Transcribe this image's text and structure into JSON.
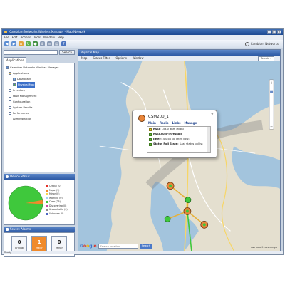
{
  "app": {
    "title": "Cambium Networks Wireless Manager - Map Network",
    "menu": [
      "File",
      "Edit",
      "Actions",
      "Tools",
      "Window",
      "Help"
    ],
    "brand": "Cambium Networks",
    "status_text": "Ready"
  },
  "left": {
    "search_button": "Search",
    "tab": "Applications",
    "tree": [
      {
        "label": "Cambium Networks Wireless Manager",
        "level": 0
      },
      {
        "label": "Applications",
        "level": 1
      },
      {
        "label": "Dashboard",
        "level": 2
      },
      {
        "label": "Physical Map",
        "level": 2,
        "selected": true
      },
      {
        "label": "Inventory",
        "level": 2
      },
      {
        "label": "Fault Management",
        "level": 2
      },
      {
        "label": "Configuration",
        "level": 2
      },
      {
        "label": "System Results",
        "level": 2
      },
      {
        "label": "Performance",
        "level": 2
      },
      {
        "label": "Administration",
        "level": 2
      }
    ]
  },
  "device_status": {
    "title": "Device Status",
    "legend": [
      {
        "label": "Critical (0)",
        "color": "#e53027"
      },
      {
        "label": "Major (1)",
        "color": "#f08a2b"
      },
      {
        "label": "Minor (0)",
        "color": "#f6d54b"
      },
      {
        "label": "Warning (0)",
        "color": "#9fd3f3"
      },
      {
        "label": "Clear (25)",
        "color": "#3fc83c"
      },
      {
        "label": "Discovering (0)",
        "color": "#c74aa3"
      },
      {
        "label": "Unreachable (0)",
        "color": "#8d8d8d"
      },
      {
        "label": "Unknown (0)",
        "color": "#4d65c3"
      }
    ],
    "pie": {
      "clear": 25,
      "major": 1
    }
  },
  "severe_alarms": {
    "title": "Severe Alarms",
    "items": [
      {
        "count": "0",
        "label": "Critical"
      },
      {
        "count": "1",
        "label": "Major"
      },
      {
        "count": "0",
        "label": "Minor"
      }
    ]
  },
  "map": {
    "title": "Physical Map",
    "menu": [
      "Map",
      "Status Filter",
      "Options",
      "Window"
    ],
    "select_value": "Terrain",
    "search_placeholder": "Search location",
    "search_button": "Search",
    "copyright": "Map data ©2012 Google",
    "google_label": "Google"
  },
  "popup": {
    "device_name": "CSM200_1",
    "links": [
      "Main",
      "Radio",
      "Links",
      "Manage"
    ],
    "rows": [
      {
        "status": "yellow",
        "label": "RSSI:",
        "value": "-53.0 dBm (high)"
      },
      {
        "status": "green",
        "label": "RSSI Auto-Threshold",
        "value": ""
      },
      {
        "status": "green",
        "label": "Jitter:",
        "value": "4.0 pp pp Jitter (low)"
      },
      {
        "status": "green",
        "label": "Status Poll State:",
        "value": "Last status poll(s)"
      }
    ]
  }
}
